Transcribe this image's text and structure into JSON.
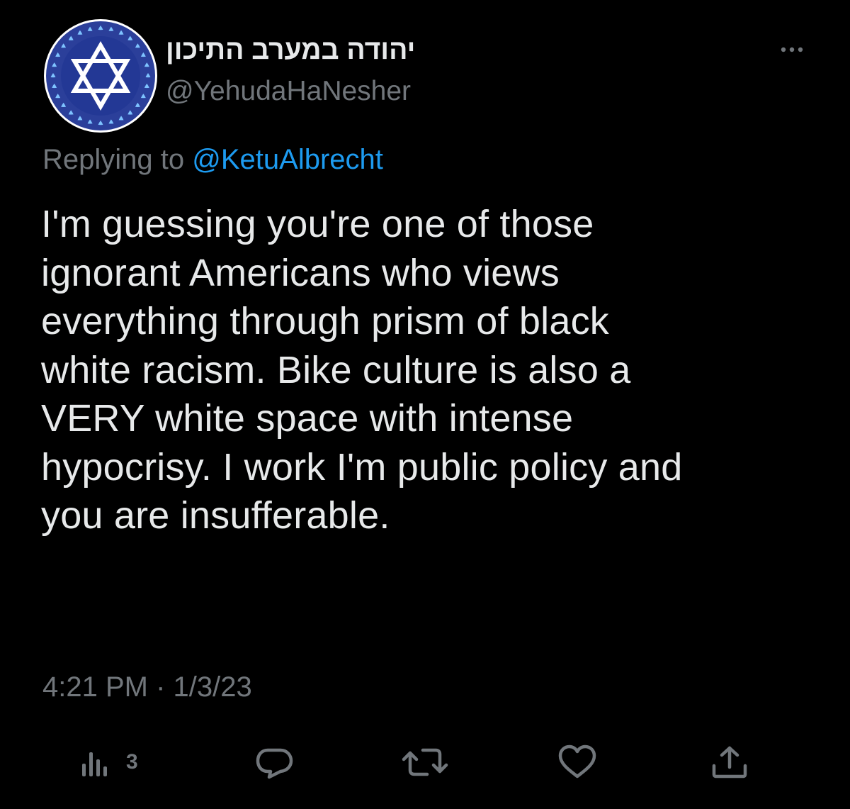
{
  "user": {
    "display_name": "יהודה במערב התיכון",
    "handle": "@YehudaHaNesher",
    "avatar_icon": "star-of-david-icon"
  },
  "reply": {
    "prefix": "Replying to",
    "mention": "@KetuAlbrecht"
  },
  "tweet": {
    "text": "I'm guessing you're one of those\nignorant Americans who views\neverything through prism of black\nwhite racism. Bike culture is also a\nVERY white space with intense\nhypocrisy. I work I'm public policy and\nyou are insufferable.",
    "timestamp": "4:21 PM · 1/3/23"
  },
  "actions": {
    "views_count": "3",
    "views_icon": "analytics-icon",
    "reply_icon": "reply-icon",
    "retweet_icon": "retweet-icon",
    "like_icon": "heart-icon",
    "share_icon": "share-icon"
  },
  "colors": {
    "background": "#000000",
    "text": "#e7e9ea",
    "secondary": "#71767b",
    "accent": "#1d9bf0",
    "avatar_blue": "#2b3f9a"
  }
}
